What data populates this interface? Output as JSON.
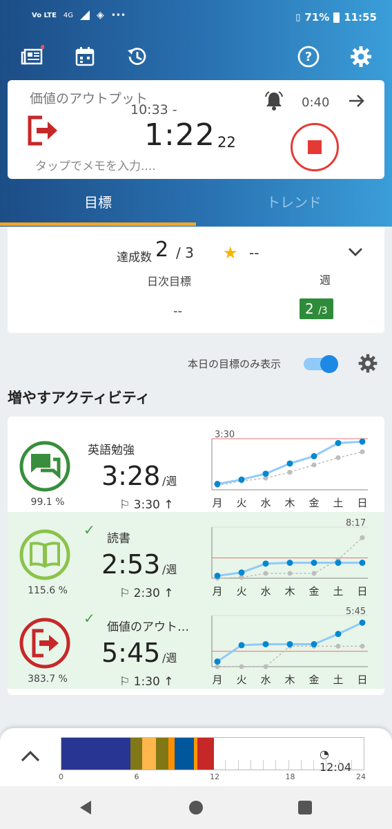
{
  "status": {
    "net_a": "Vo LTE",
    "net_b": "4G",
    "battery": "71%",
    "time": "11:55"
  },
  "timer": {
    "title": "価値のアウトプット",
    "start": "10:33 -",
    "elapsed": "1:22",
    "seconds": "22",
    "memo_placeholder": "タップでメモを入力....",
    "alarm": "0:40"
  },
  "tabs": [
    {
      "label": "目標"
    },
    {
      "label": "トレンド"
    }
  ],
  "summary": {
    "achieved_label": "達成数",
    "achieved": "2",
    "total": "/ 3",
    "star_value": "--",
    "daily_label": "日次目標",
    "weekly_label": "週",
    "daily_value": "--",
    "weekly_badge_main": "2",
    "weekly_badge_sub": "/3"
  },
  "filter": {
    "label": "本日の目標のみ表示",
    "on": true
  },
  "section_title": "増やすアクティビティ",
  "chart_data": [
    {
      "type": "line",
      "activity": "英語勉強",
      "x": [
        "月",
        "火",
        "水",
        "木",
        "金",
        "土",
        "日"
      ],
      "annotation": "3:30",
      "series": [
        {
          "values": [
            0.4,
            0.7,
            1.1,
            1.8,
            2.3,
            3.2,
            3.3
          ]
        },
        {
          "values": [
            0.3,
            0.6,
            0.8,
            1.2,
            1.7,
            2.2,
            2.6
          ]
        }
      ],
      "ylim": [
        0,
        3.5
      ]
    },
    {
      "type": "line",
      "activity": "読書",
      "x": [
        "月",
        "火",
        "水",
        "木",
        "金",
        "土",
        "日"
      ],
      "annotation": "8:17",
      "series": [
        {
          "values": [
            0.3,
            0.7,
            1.8,
            1.9,
            1.9,
            1.9,
            1.9
          ]
        },
        {
          "values": [
            0,
            0.1,
            0.6,
            0.6,
            0.6,
            2.3,
            5.0
          ]
        }
      ],
      "ylim": [
        0,
        6.3
      ]
    },
    {
      "type": "line",
      "activity": "価値のアウトプット",
      "x": [
        "月",
        "火",
        "水",
        "木",
        "金",
        "土",
        "日"
      ],
      "annotation": "5:45",
      "series": [
        {
          "values": [
            0.5,
            2.1,
            2.2,
            2.2,
            2.2,
            3.2,
            4.3
          ]
        },
        {
          "values": [
            0,
            0,
            0,
            2.0,
            2.0,
            2.0,
            2.0
          ]
        }
      ],
      "ylim": [
        0,
        5.0
      ]
    }
  ],
  "activities": [
    {
      "name": "英語勉強",
      "time": "3:28",
      "unit": "/週",
      "goal": "3:30 ↑",
      "percent": "99.1 %",
      "done": false,
      "color": "#388e3c"
    },
    {
      "name": "読書",
      "time": "2:53",
      "unit": "/週",
      "goal": "2:30 ↑",
      "percent": "115.6 %",
      "done": true,
      "color": "#8bc34a"
    },
    {
      "name": "価値のアウト…",
      "time": "5:45",
      "unit": "/週",
      "goal": "1:30 ↑",
      "percent": "383.7 %",
      "done": true,
      "color": "#c62828"
    }
  ],
  "timeline": {
    "labels": [
      "0",
      "6",
      "12",
      "18",
      "24"
    ],
    "current": "12:04",
    "segments": [
      {
        "from": 0,
        "to": 5.5,
        "color": "#283593"
      },
      {
        "from": 5.5,
        "to": 6.4,
        "color": "#827717"
      },
      {
        "from": 6.4,
        "to": 7.5,
        "color": "#ffb74d"
      },
      {
        "from": 7.5,
        "to": 8.5,
        "color": "#827717"
      },
      {
        "from": 8.5,
        "to": 9.0,
        "color": "#ff8f00"
      },
      {
        "from": 9.0,
        "to": 10.5,
        "color": "#01579b"
      },
      {
        "from": 10.5,
        "to": 10.8,
        "color": "#ff9800"
      },
      {
        "from": 10.8,
        "to": 12.1,
        "color": "#c62828"
      }
    ]
  }
}
